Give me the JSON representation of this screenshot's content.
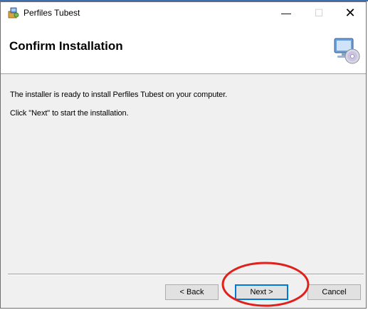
{
  "window": {
    "title": "Perfiles Tubest",
    "controls": {
      "minimize": "—",
      "maximize": "☐",
      "close": "✕"
    },
    "app_icon": "installer-icon"
  },
  "header": {
    "title": "Confirm Installation",
    "icon": "computer-cd-icon"
  },
  "content": {
    "line1": "The installer is ready to install Perfiles Tubest on your computer.",
    "line2": "Click \"Next\" to start the installation."
  },
  "buttons": {
    "back": "< Back",
    "next": "Next >",
    "cancel": "Cancel"
  },
  "colors": {
    "annotation_circle": "#e0201b",
    "accent": "#0078d7"
  }
}
